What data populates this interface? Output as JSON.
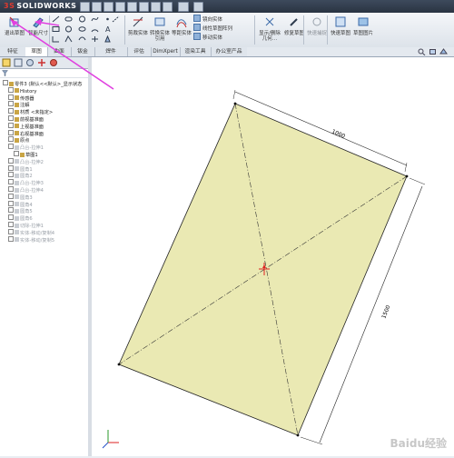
{
  "app": {
    "name": "SOLIDWORKS",
    "brand": "3S"
  },
  "colors": {
    "accent": "#e040e0",
    "sheet": "#eae9b3",
    "dim_text": "#000000"
  },
  "ribbon": {
    "exit_sketch": "退出草图",
    "smart_dim": "智能尺寸",
    "buttons": [
      {
        "label": "剪裁实体",
        "icon": "trim-icon"
      },
      {
        "label": "转换实体引用",
        "icon": "convert-icon"
      },
      {
        "label": "等距实体",
        "icon": "offset-icon"
      }
    ],
    "rows": [
      "镜向实体",
      "线性草图阵列",
      "移动实体"
    ],
    "display": "显示/删除几何…",
    "repair": "修复草图",
    "quick_snap": "快速捕捉",
    "quick_sketch": "快速草图",
    "sketch_pic": "草图图片"
  },
  "tabs": [
    "特征",
    "草图",
    "曲面",
    "钣金",
    "焊件",
    "评估",
    "DimXpert",
    "渲染工具",
    "办公室产品"
  ],
  "tree": [
    {
      "label": "零件3 (默认<<默认>_显示状态",
      "grey": false,
      "indent": 0
    },
    {
      "label": "History",
      "grey": false,
      "indent": 1
    },
    {
      "label": "传感器",
      "grey": false,
      "indent": 1
    },
    {
      "label": "注解",
      "grey": false,
      "indent": 1
    },
    {
      "label": "材质 <未指定>",
      "grey": false,
      "indent": 1
    },
    {
      "label": "前视基准面",
      "grey": false,
      "indent": 1
    },
    {
      "label": "上视基准面",
      "grey": false,
      "indent": 1
    },
    {
      "label": "右视基准面",
      "grey": false,
      "indent": 1
    },
    {
      "label": "原点",
      "grey": false,
      "indent": 1
    },
    {
      "label": "凸台-拉伸1",
      "grey": true,
      "indent": 1
    },
    {
      "label": "草图1",
      "grey": false,
      "indent": 2
    },
    {
      "label": "凸台-拉伸2",
      "grey": true,
      "indent": 1
    },
    {
      "label": "圆角1",
      "grey": true,
      "indent": 1
    },
    {
      "label": "圆角2",
      "grey": true,
      "indent": 1
    },
    {
      "label": "凸台-拉伸3",
      "grey": true,
      "indent": 1
    },
    {
      "label": "凸台-拉伸4",
      "grey": true,
      "indent": 1
    },
    {
      "label": "圆角3",
      "grey": true,
      "indent": 1
    },
    {
      "label": "圆角4",
      "grey": true,
      "indent": 1
    },
    {
      "label": "圆角5",
      "grey": true,
      "indent": 1
    },
    {
      "label": "圆角6",
      "grey": true,
      "indent": 1
    },
    {
      "label": "切除-拉伸1",
      "grey": true,
      "indent": 1
    },
    {
      "label": "实体-移动/复制4",
      "grey": true,
      "indent": 1
    },
    {
      "label": "实体-移动/复制5",
      "grey": true,
      "indent": 1
    }
  ],
  "sketch": {
    "dim_top": "1000",
    "dim_right": "1500"
  },
  "watermark": "Baidu经验"
}
